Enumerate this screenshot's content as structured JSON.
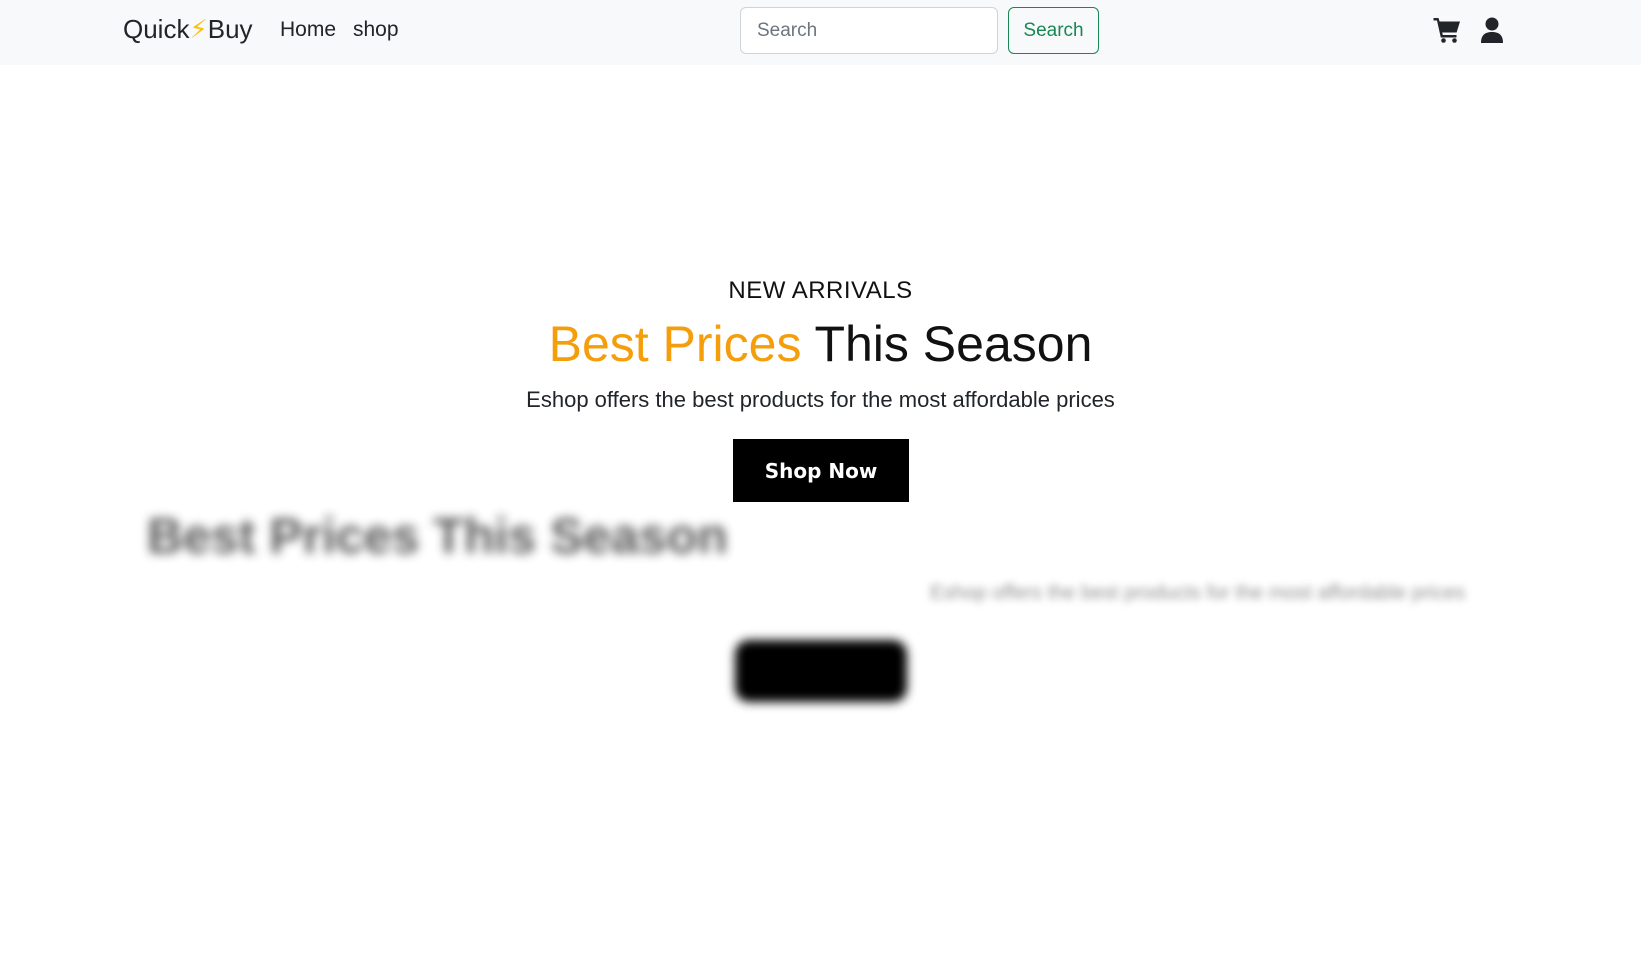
{
  "navbar": {
    "brand_left": "Quick",
    "brand_bolt": "⚡",
    "brand_right": "Buy",
    "links": [
      {
        "label": "Home"
      },
      {
        "label": "shop"
      }
    ],
    "search": {
      "placeholder": "Search",
      "value": "",
      "button_label": "Search"
    },
    "icons": [
      "cart-icon",
      "user-icon"
    ]
  },
  "hero": {
    "eyebrow": "NEW ARRIVALS",
    "headline_accent": "Best Prices",
    "headline_rest": " This Season",
    "subtitle": "Eshop offers the best products for the most affordable prices",
    "cta_label": "Shop Now"
  },
  "ghost": {
    "title": "Best Prices This Season",
    "subtitle": "Eshop offers the best products for the most affordable prices"
  },
  "colors": {
    "accent": "#f59e0b",
    "success": "#198754",
    "navbar_bg": "#f8f9fa",
    "bolt": "#ffc107"
  }
}
